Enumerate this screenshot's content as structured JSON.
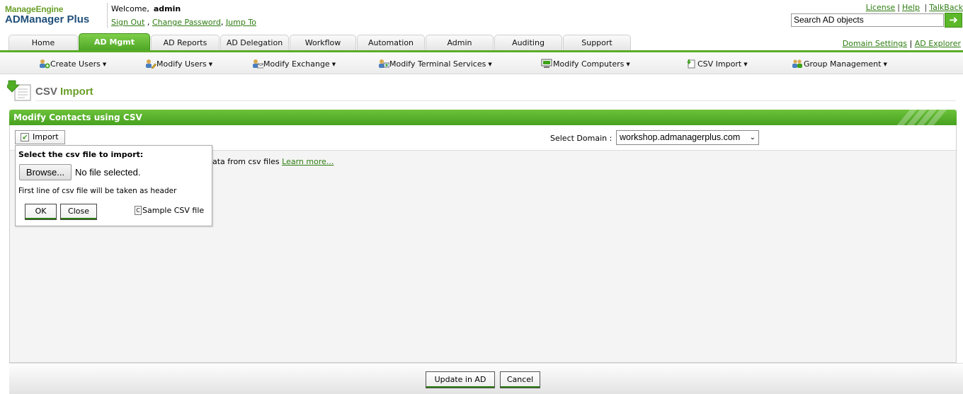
{
  "branding": {
    "company": "ManageEngine",
    "product": "ADManager Plus"
  },
  "user": {
    "welcome": "Welcome,",
    "name": "admin"
  },
  "user_links": {
    "sign_out": "Sign Out",
    "change_password": "Change Password",
    "jump_to": "Jump To"
  },
  "top_links": {
    "license": "License",
    "help": "Help",
    "talkback": "TalkBack"
  },
  "search": {
    "value": "Search AD objects",
    "go_icon": "arrow-right-icon"
  },
  "tabs": [
    {
      "label": "Home"
    },
    {
      "label": "AD Mgmt",
      "active": true
    },
    {
      "label": "AD Reports"
    },
    {
      "label": "AD Delegation"
    },
    {
      "label": "Workflow"
    },
    {
      "label": "Automation"
    },
    {
      "label": "Admin"
    },
    {
      "label": "Auditing"
    },
    {
      "label": "Support"
    }
  ],
  "right_links": {
    "domain_settings": "Domain Settings",
    "ad_explorer": "AD Explorer"
  },
  "submenu": [
    {
      "label": "Create Users",
      "icon": "create-users-icon"
    },
    {
      "label": "Modify Users",
      "icon": "modify-users-icon"
    },
    {
      "label": "Modify Exchange",
      "icon": "modify-exchange-icon"
    },
    {
      "label": "Modify Terminal Services",
      "icon": "terminal-services-icon"
    },
    {
      "label": "Modify Computers",
      "icon": "computer-icon"
    },
    {
      "label": "CSV Import",
      "icon": "csv-import-icon"
    },
    {
      "label": "Group Management",
      "icon": "group-management-icon"
    }
  ],
  "page": {
    "title_part1": "CSV",
    "title_part2": "Import"
  },
  "panel": {
    "title": "Modify Contacts using CSV",
    "import_button": "Import",
    "domain_label": "Select Domain :",
    "domain_value": "workshop.admanagerplus.com",
    "description": "ata from csv files",
    "learn_more": "Learn more..."
  },
  "popup": {
    "label": "Select the csv file to import:",
    "browse": "Browse...",
    "no_file": "No file selected.",
    "hint": "First line of csv file will be taken as header",
    "ok": "OK",
    "close": "Close",
    "sample": "Sample CSV file"
  },
  "footer": {
    "update": "Update in AD",
    "cancel": "Cancel"
  },
  "colors": {
    "brand_green": "#5aad27",
    "link_green": "#2e7d12",
    "brand_blue": "#1f4f7a"
  }
}
